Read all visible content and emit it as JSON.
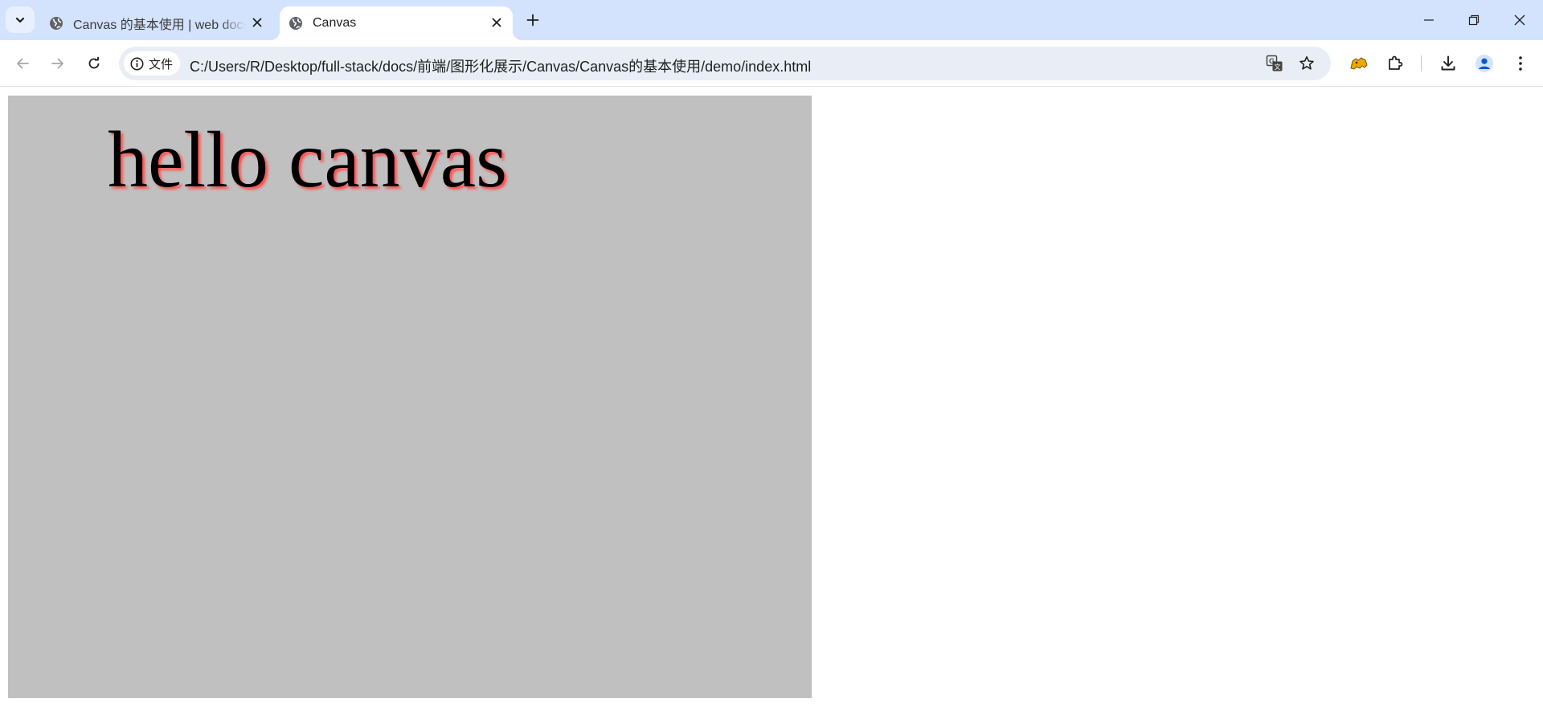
{
  "browser": {
    "tabs": [
      {
        "title": "Canvas 的基本使用 | web docs",
        "active": false,
        "favicon": "globe-icon"
      },
      {
        "title": "Canvas",
        "active": true,
        "favicon": "globe-icon"
      }
    ],
    "address_bar": {
      "site_chip_label": "文件",
      "url": "C:/Users/R/Desktop/full-stack/docs/前端/图形化展示/Canvas/Canvas的基本使用/demo/index.html"
    },
    "colors": {
      "tabstrip_bg": "#d3e3fd",
      "omnibox_bg": "#e9eef6",
      "accent": "#0b57d0",
      "extension_icon": "#e8a900"
    }
  },
  "page": {
    "canvas": {
      "background": "#c0c0c0",
      "text": "hello canvas",
      "text_color": "#000000",
      "shadow_color": "#ff4d4d"
    }
  }
}
